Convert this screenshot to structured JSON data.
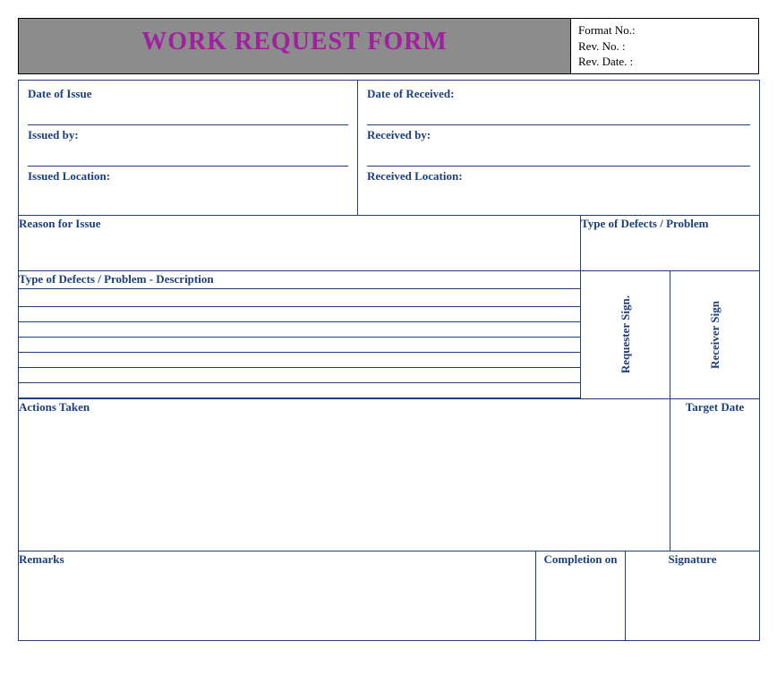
{
  "header": {
    "title": "WORK REQUEST FORM",
    "meta": {
      "format_no": "Format No.:",
      "rev_no": "Rev. No.    :",
      "rev_date": "Rev. Date.  :"
    }
  },
  "issue": {
    "date_of_issue": "Date of Issue",
    "issued_by": "Issued by:",
    "issued_location": "Issued Location:"
  },
  "received": {
    "date_of_received": "Date of Received:",
    "received_by": "Received by:",
    "received_location": "Received Location:"
  },
  "sections": {
    "reason_for_issue": "Reason for Issue",
    "type_of_defects": "Type of Defects / Problem",
    "description": "Type of Defects / Problem - Description",
    "requester_sign": "Requester Sign.",
    "receiver_sign": "Receiver Sign",
    "actions_taken": "Actions Taken",
    "target_date": "Target Date",
    "remarks": "Remarks",
    "completion_on": "Completion on",
    "signature": "Signature"
  }
}
